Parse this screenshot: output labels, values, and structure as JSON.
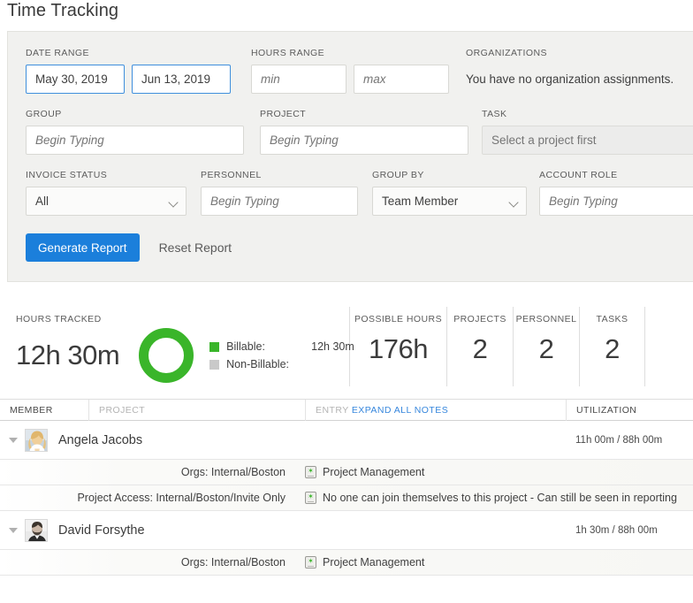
{
  "page": {
    "title": "Time Tracking"
  },
  "colors": {
    "accent_blue": "#1b7fdb",
    "link_blue": "#3787dd",
    "billable_green": "#3ab52a",
    "nonbillable_gray": "#c9c9c9",
    "panel_bg": "#f1f1ef"
  },
  "filters": {
    "date_range": {
      "label": "DATE RANGE",
      "start_value": "May 30, 2019",
      "end_value": "Jun 13, 2019"
    },
    "hours_range": {
      "label": "HOURS RANGE",
      "min_placeholder": "min",
      "min_value": "",
      "max_placeholder": "max",
      "max_value": ""
    },
    "organizations": {
      "label": "ORGANIZATIONS",
      "message": "You have no organization assignments."
    },
    "group": {
      "label": "GROUP",
      "placeholder": "Begin Typing",
      "value": ""
    },
    "project": {
      "label": "PROJECT",
      "placeholder": "Begin Typing",
      "value": ""
    },
    "task": {
      "label": "TASK",
      "placeholder": "Select a project first",
      "value": "",
      "disabled": true
    },
    "invoice_status": {
      "label": "INVOICE STATUS",
      "value": "All",
      "options": [
        "All"
      ]
    },
    "personnel": {
      "label": "PERSONNEL",
      "placeholder": "Begin Typing",
      "value": ""
    },
    "group_by": {
      "label": "GROUP BY",
      "value": "Team Member",
      "options": [
        "Team Member"
      ]
    },
    "account_role": {
      "label": "ACCOUNT ROLE",
      "placeholder": "Begin Typing",
      "value": ""
    },
    "generate_label": "Generate Report",
    "reset_label": "Reset Report"
  },
  "stats": {
    "hours_tracked": {
      "caption": "HOURS TRACKED",
      "value": "12h 30m"
    },
    "legend": {
      "billable_label": "Billable:",
      "billable_value": "12h 30m",
      "nonbillable_label": "Non-Billable:",
      "nonbillable_value": ""
    },
    "possible_hours": {
      "caption": "POSSIBLE HOURS",
      "value": "176h"
    },
    "projects": {
      "caption": "PROJECTS",
      "value": "2"
    },
    "personnel": {
      "caption": "PERSONNEL",
      "value": "2"
    },
    "tasks": {
      "caption": "TASKS",
      "value": "2"
    }
  },
  "chart_data": {
    "type": "pie",
    "title": "Hours Tracked",
    "categories": [
      "Billable",
      "Non-Billable"
    ],
    "values": [
      12.5,
      0
    ],
    "value_labels": [
      "12h 30m",
      ""
    ],
    "colors": [
      "#3ab52a",
      "#c9c9c9"
    ],
    "total": "12h 30m",
    "legend": "right",
    "donut": true
  },
  "table": {
    "headers": {
      "member": "MEMBER",
      "project": "PROJECT",
      "entry": "ENTRY",
      "entry_link": "EXPAND ALL NOTES",
      "utilization": "UTILIZATION"
    },
    "rows": [
      {
        "name": "Angela Jacobs",
        "utilization": "11h 00m / 88h 00m",
        "details": [
          {
            "project": "Orgs: Internal/Boston",
            "entry": "Project Management"
          },
          {
            "project": "Project Access: Internal/Boston/Invite Only",
            "entry": "No one can join themselves to this project - Can still be seen in reporting"
          }
        ]
      },
      {
        "name": "David Forsythe",
        "utilization": "1h 30m / 88h 00m",
        "details": [
          {
            "project": "Orgs: Internal/Boston",
            "entry": "Project Management"
          }
        ]
      }
    ]
  }
}
